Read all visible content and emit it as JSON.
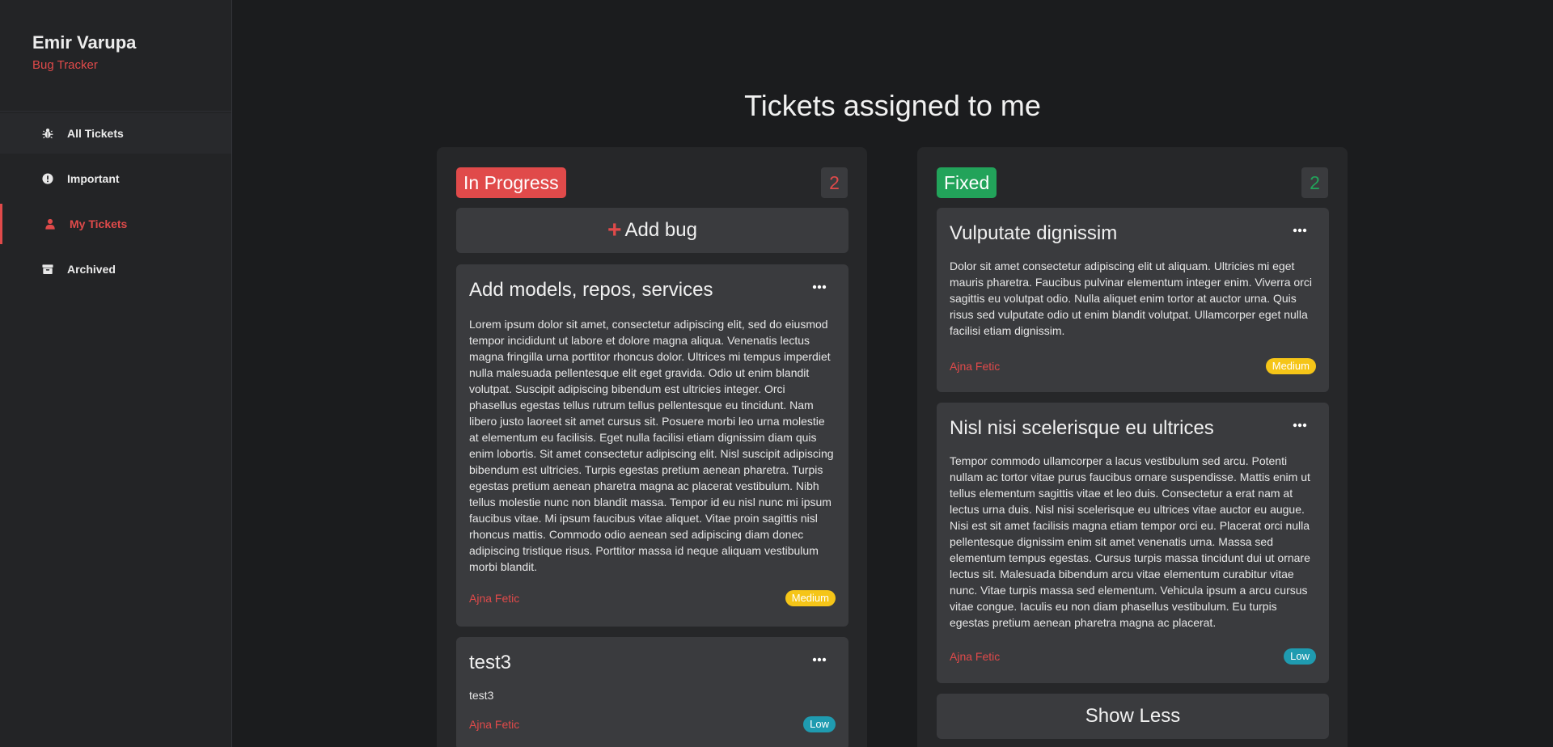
{
  "brand": {
    "name": "Emir Varupa",
    "subtitle": "Bug Tracker"
  },
  "nav": [
    {
      "label": "All Tickets",
      "icon": "bug-icon"
    },
    {
      "label": "Important",
      "icon": "exclamation-circle-icon"
    },
    {
      "label": "My Tickets",
      "icon": "user-icon",
      "active": true
    },
    {
      "label": "Archived",
      "icon": "archive-icon"
    }
  ],
  "page_title": "Tickets assigned to me",
  "colors": {
    "accent": "#e04a4a",
    "fixed": "#22a35a",
    "medium": "#f5c518",
    "low": "#1f9bb0"
  },
  "columns": {
    "in_progress": {
      "label": "In Progress",
      "count": "2",
      "add_label": "Add bug",
      "cards": [
        {
          "title": "Add models, repos, services",
          "description": "Lorem ipsum dolor sit amet, consectetur adipiscing elit, sed do eiusmod tempor incididunt ut labore et dolore magna aliqua. Venenatis lectus magna fringilla urna porttitor rhoncus dolor. Ultrices mi tempus imperdiet nulla malesuada pellentesque elit eget gravida. Odio ut enim blandit volutpat. Suscipit adipiscing bibendum est ultricies integer. Orci phasellus egestas tellus rutrum tellus pellentesque eu tincidunt. Nam libero justo laoreet sit amet cursus sit. Posuere morbi leo urna molestie at elementum eu facilisis. Eget nulla facilisi etiam dignissim diam quis enim lobortis. Sit amet consectetur adipiscing elit. Nisl suscipit adipiscing bibendum est ultricies. Turpis egestas pretium aenean pharetra. Turpis egestas pretium aenean pharetra magna ac placerat vestibulum. Nibh tellus molestie nunc non blandit massa. Tempor id eu nisl nunc mi ipsum faucibus vitae. Mi ipsum faucibus vitae aliquet. Vitae proin sagittis nisl rhoncus mattis. Commodo odio aenean sed adipiscing diam donec adipiscing tristique risus. Porttitor massa id neque aliquam vestibulum morbi blandit.",
          "assignee": "Ajna Fetic",
          "priority": "Medium"
        },
        {
          "title": "test3",
          "description": "test3",
          "assignee": "Ajna Fetic",
          "priority": "Low"
        }
      ]
    },
    "fixed": {
      "label": "Fixed",
      "count": "2",
      "show_less_label": "Show Less",
      "cards": [
        {
          "title": "Vulputate dignissim",
          "description": "Dolor sit amet consectetur adipiscing elit ut aliquam. Ultricies mi eget mauris pharetra. Faucibus pulvinar elementum integer enim. Viverra orci sagittis eu volutpat odio. Nulla aliquet enim tortor at auctor urna. Quis risus sed vulputate odio ut enim blandit volutpat. Ullamcorper eget nulla facilisi etiam dignissim.",
          "assignee": "Ajna Fetic",
          "priority": "Medium"
        },
        {
          "title": "Nisl nisi scelerisque eu ultrices",
          "description": "Tempor commodo ullamcorper a lacus vestibulum sed arcu. Potenti nullam ac tortor vitae purus faucibus ornare suspendisse. Mattis enim ut tellus elementum sagittis vitae et leo duis. Consectetur a erat nam at lectus urna duis. Nisl nisi scelerisque eu ultrices vitae auctor eu augue. Nisi est sit amet facilisis magna etiam tempor orci eu. Placerat orci nulla pellentesque dignissim enim sit amet venenatis urna. Massa sed elementum tempus egestas. Cursus turpis massa tincidunt dui ut ornare lectus sit. Malesuada bibendum arcu vitae elementum curabitur vitae nunc. Vitae turpis massa sed elementum. Vehicula ipsum a arcu cursus vitae congue. Iaculis eu non diam phasellus vestibulum. Eu turpis egestas pretium aenean pharetra magna ac placerat.",
          "assignee": "Ajna Fetic",
          "priority": "Low"
        }
      ]
    }
  }
}
